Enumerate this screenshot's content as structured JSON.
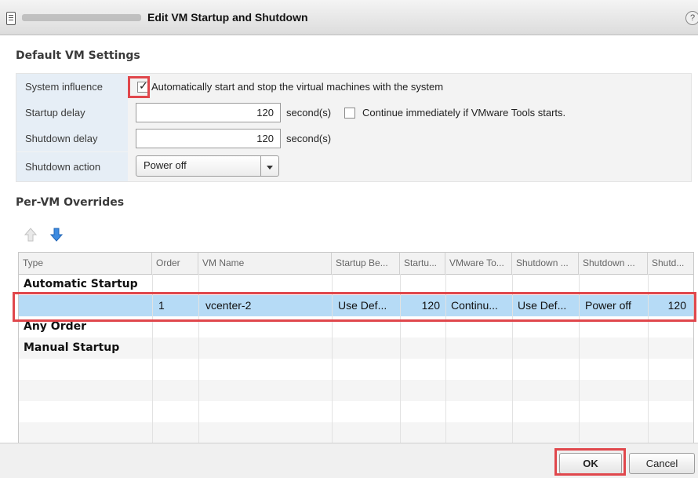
{
  "window": {
    "title": "Edit VM Startup and Shutdown",
    "help_glyph": "?"
  },
  "default_settings": {
    "section_title": "Default VM Settings",
    "system_influence": {
      "label": "System influence",
      "checked": true,
      "checkbox_label": "Automatically start and stop the virtual machines with the system"
    },
    "startup_delay": {
      "label": "Startup delay",
      "value": "120",
      "unit": "second(s)",
      "continue_checked": false,
      "continue_label": "Continue immediately if VMware Tools starts."
    },
    "shutdown_delay": {
      "label": "Shutdown delay",
      "value": "120",
      "unit": "second(s)"
    },
    "shutdown_action": {
      "label": "Shutdown action",
      "value": "Power off"
    }
  },
  "overrides": {
    "section_title": "Per-VM Overrides",
    "columns": [
      "Type",
      "Order",
      "VM Name",
      "Startup Be...",
      "Startu...",
      "VMware To...",
      "Shutdown ...",
      "Shutdown ...",
      "Shutd..."
    ],
    "groups": {
      "automatic": "Automatic Startup",
      "any": "Any Order",
      "manual": "Manual Startup"
    },
    "rows": [
      {
        "order": "1",
        "vm_name": "vcenter-2",
        "startup_behavior": "Use Def...",
        "startup_delay": "120",
        "vmware_tools": "Continu...",
        "shutdown_behavior": "Use Def...",
        "shutdown_action": "Power off",
        "shutdown_delay": "120"
      }
    ]
  },
  "footer": {
    "ok_label": "OK",
    "cancel_label": "Cancel"
  },
  "colors": {
    "highlight": "#e0474c",
    "selected_row": "#b6dbf6",
    "label_bg": "#e6eef6"
  }
}
